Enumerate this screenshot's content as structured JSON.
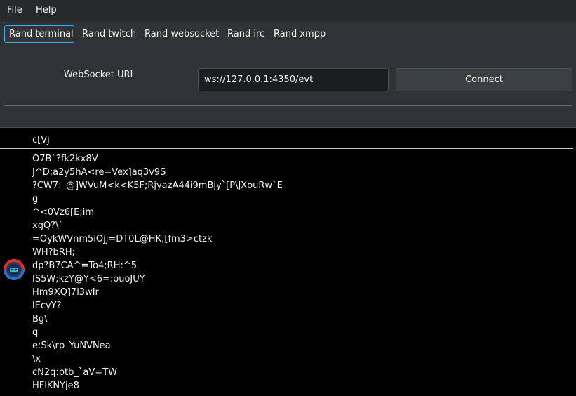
{
  "menu": {
    "file": "File",
    "help": "Help"
  },
  "tabs": [
    {
      "label": "Rand terminal",
      "active": true
    },
    {
      "label": "Rand twitch",
      "active": false
    },
    {
      "label": "Rand websocket",
      "active": false
    },
    {
      "label": "Rand irc",
      "active": false
    },
    {
      "label": "Rand xmpp",
      "active": false
    }
  ],
  "form": {
    "uri_label": "WebSocket URI",
    "uri_value": "ws://127.0.0.1:4350/evt",
    "connect_label": "Connect"
  },
  "terminal": {
    "header": "c[Vj",
    "icon": "irc-badge-icon",
    "lines": [
      "O7B`?fk2kx8V",
      "J^D;a2y5hA<re=Vex]aq3v9S",
      "?CW7:_@]WVuM<k<K5F;RjyazA44i9mBjy`[P\\JXouRw`E",
      "g",
      "^<0Vz6[E;im",
      "xgQ?\\`",
      "=OykWVnm5iOjj=DT0L@HK;[fm3>ctzk",
      "WH?bRH;",
      "dp?B7CA^=To4;RH:^5",
      "IS5W;kzY@Y<6=:ouoJUY",
      "Hm9XQ]7l3wIr",
      "lEcyY?",
      "Bg\\",
      "q",
      "e:Sk\\rp_YuNVNea",
      "\\x",
      "cN2q:ptb_`aV=TW",
      "HFlKNYje8_"
    ]
  },
  "colors": {
    "accent": "#3daee9",
    "window_bg": "#2f3337",
    "terminal_bg": "#000000"
  }
}
